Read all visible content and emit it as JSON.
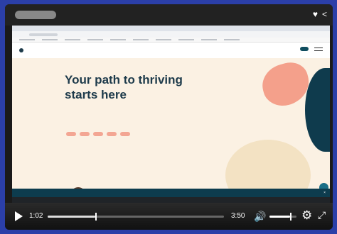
{
  "player": {
    "current_time": "1:02",
    "duration": "3:50",
    "progress": 0.27,
    "volume": 0.75,
    "icons": {
      "play": "play-icon",
      "volume": "volume-icon",
      "settings": "gear-icon",
      "fullscreen": "fullscreen-icon",
      "like": "heart-icon",
      "share": "share-icon"
    }
  },
  "hero": {
    "title": "Your path to thriving starts here"
  },
  "colors": {
    "background": "#2b3fa8",
    "hero": "#fbf1e3",
    "accent_pink": "#f4a08b",
    "accent_teal": "#0f3b4d"
  }
}
